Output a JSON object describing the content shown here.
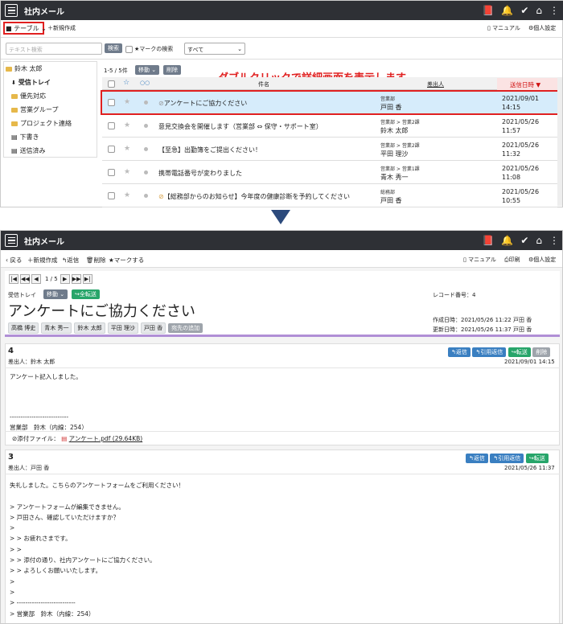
{
  "app": {
    "title": "社内メール"
  },
  "list_view": {
    "toolbar": {
      "view_select": "テーブル",
      "new_label": "新規作成",
      "manual": "マニュアル",
      "settings": "個人設定"
    },
    "search": {
      "placeholder": "テキスト検索",
      "button": "検索",
      "mark_search": "マークの検索",
      "filter": "すべて"
    },
    "sidebar": {
      "user": "鈴木 太郎",
      "items": [
        {
          "label": "受信トレイ",
          "active": true
        },
        {
          "label": "優先対応"
        },
        {
          "label": "営業グループ"
        },
        {
          "label": "プロジェクト連絡"
        },
        {
          "label": "下書き"
        },
        {
          "label": "送信済み"
        }
      ]
    },
    "count": "1-5 / 5件",
    "move": "移動",
    "delete": "削除",
    "annotation": "ダブルクリックで詳細画面を表示します",
    "columns": {
      "subject": "件名",
      "sender": "差出人",
      "date": "送信日時 ▼"
    },
    "rows": [
      {
        "subject": "アンケートにご協力ください",
        "dept": "営業部",
        "name": "戸田 香",
        "date": "2021/09/01",
        "time": "14:15",
        "attach": true
      },
      {
        "subject": "意見交換会を開催します（営業部 ⇔ 保守・サポート室）",
        "dept": "営業部 > 営業2課",
        "name": "鈴木 太郎",
        "date": "2021/05/26",
        "time": "11:57"
      },
      {
        "subject": "【至急】出勤簿をご提出ください！",
        "dept": "営業部 > 営業2課",
        "name": "平田 理沙",
        "date": "2021/05/26",
        "time": "11:32"
      },
      {
        "subject": "携帯電話番号が変わりました",
        "dept": "営業部 > 営業1課",
        "name": "青木 秀一",
        "date": "2021/05/26",
        "time": "11:08"
      },
      {
        "subject": "【総務部からのお知らせ】今年度の健康診断を予約してください",
        "dept": "総務部",
        "name": "戸田 香",
        "date": "2021/05/26",
        "time": "10:55",
        "attach": true
      }
    ]
  },
  "detail_view": {
    "toolbar": {
      "back": "戻る",
      "new": "新規作成",
      "reply": "返信",
      "delete": "削除",
      "mark": "マークする",
      "manual": "マニュアル",
      "print": "印刷",
      "settings": "個人設定"
    },
    "pager": "1 / 5",
    "folder": "受信トレイ",
    "move": "移動",
    "reply_all": "全転送",
    "record": "レコード番号：4",
    "subject": "アンケートにご協力ください",
    "created": "作成日時：2021/05/26 11:22 戸田 香",
    "updated": "更新日時：2021/05/26 11:37 戸田 香",
    "recipients": [
      "高橋 博史",
      "青木 秀一",
      "鈴木 太郎",
      "平田 理沙",
      "戸田 香"
    ],
    "add_recipient": "宛先の追加",
    "messages": [
      {
        "num": "4",
        "sender": "差出人：鈴木 太郎",
        "date": "2021/09/01 14:15",
        "buttons": [
          "返信",
          "引用返信",
          "転送",
          "削除"
        ],
        "body": "アンケート記入しました。\n\n\n\n---------------------------\n営業部　鈴木（内線：254）",
        "attachment_label": "添付ファイル：",
        "attachment": "アンケート.pdf (29.64KB)"
      },
      {
        "num": "3",
        "sender": "差出人：戸田 香",
        "date": "2021/05/26 11:37",
        "buttons": [
          "返信",
          "引用返信",
          "転送"
        ],
        "body": "失礼しました。こちらのアンケートフォームをご利用ください！\n\n> アンケートフォームが編集できません。\n> 戸田さん、確認していただけますか？\n>\n> > お疲れさまです。\n> >\n> > 添付の通り、社内アンケートにご協力ください。\n> > よろしくお願いいたします。\n>\n>\n> ---------------------------\n> 営業部　鈴木（内線：254）"
      }
    ]
  },
  "colors": {
    "topbar": "#2e3035",
    "highlight_border": "#e02020",
    "selected_row": "#d6ecfb",
    "accent_red": "#e02020",
    "arrow": "#2c4a7c"
  }
}
